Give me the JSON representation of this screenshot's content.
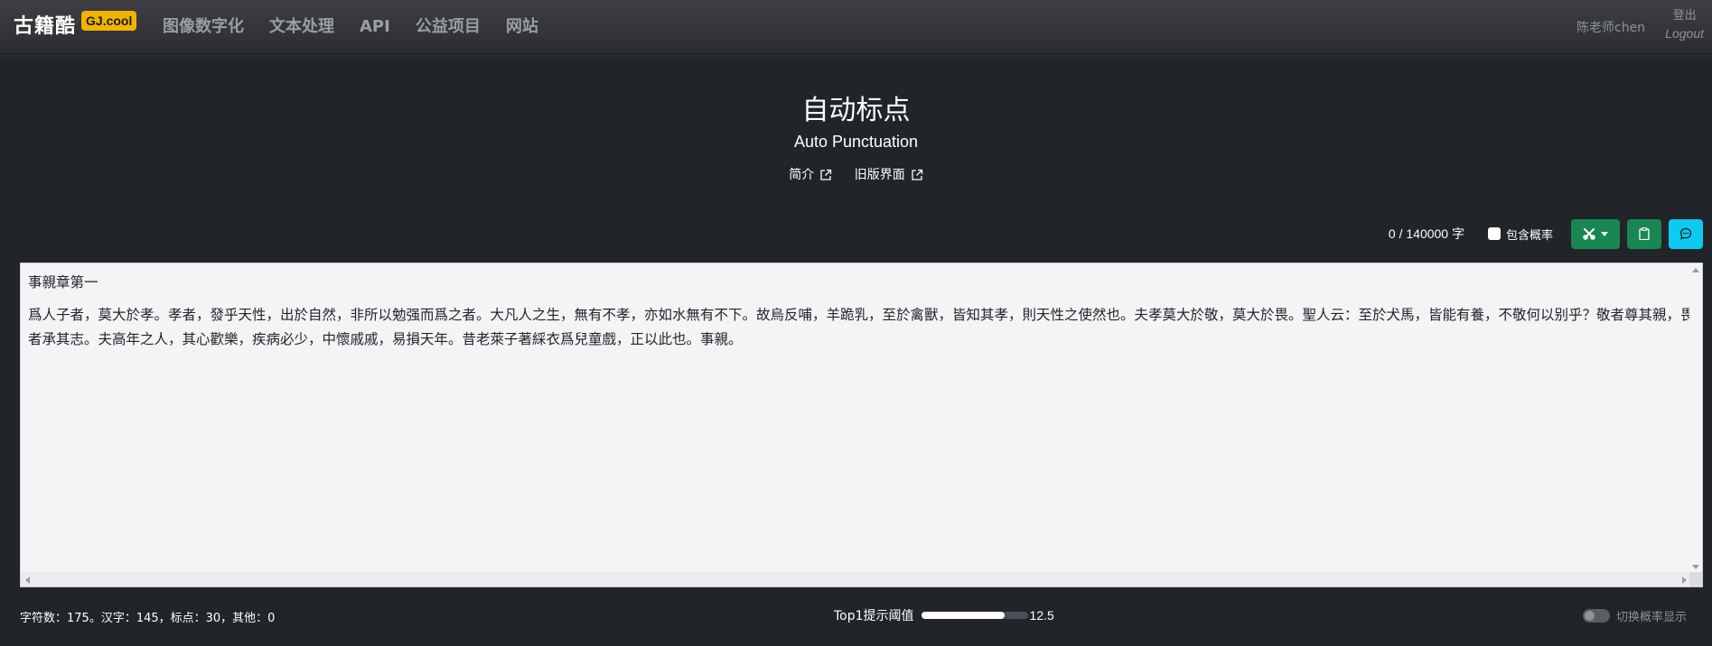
{
  "navbar": {
    "brand": "古籍酷",
    "badge": "GJ.cool",
    "links": [
      "图像数字化",
      "文本处理",
      "API",
      "公益项目",
      "网站"
    ],
    "user": "陈老师chen",
    "logout_zh": "登出",
    "logout_en": "Logout"
  },
  "page": {
    "title": "自动标点",
    "subtitle": "Auto Punctuation",
    "links": [
      "简介",
      "旧版界面"
    ]
  },
  "toolbar": {
    "char_count": "0 / 140000 字",
    "include_prob_label": "包含概率",
    "include_prob_checked": false,
    "colors": {
      "green": "#198754",
      "cyan": "#0dcaf0"
    }
  },
  "editor": {
    "lines": [
      "事親章第一",
      "爲人子者，莫大於孝。孝者，發乎天性，出於自然，非所以勉强而爲之者。大凡人之生，無有不孝，亦如水無有不下。故烏反哺，羊跪乳，至於禽獸，皆知其孝，則天性之使然也。夫孝莫大於敬，莫大於畏。聖人云：至於犬馬，皆能有養，不敬何以别乎？敬者尊其親，畏者承其志。夫高年之人，其心歡樂，疾病必少，中懷戚戚，易損天年。昔老萊子著綵衣爲兒童戲，正以此也。事親。"
    ]
  },
  "footer": {
    "stats": "字符数：175。汉字：145，标点：30，其他：0",
    "threshold_label": "Top1提示阈值",
    "threshold_value": "12.5",
    "threshold_fraction": 0.78,
    "toggle_label": "切换概率显示",
    "toggle_on": false
  }
}
